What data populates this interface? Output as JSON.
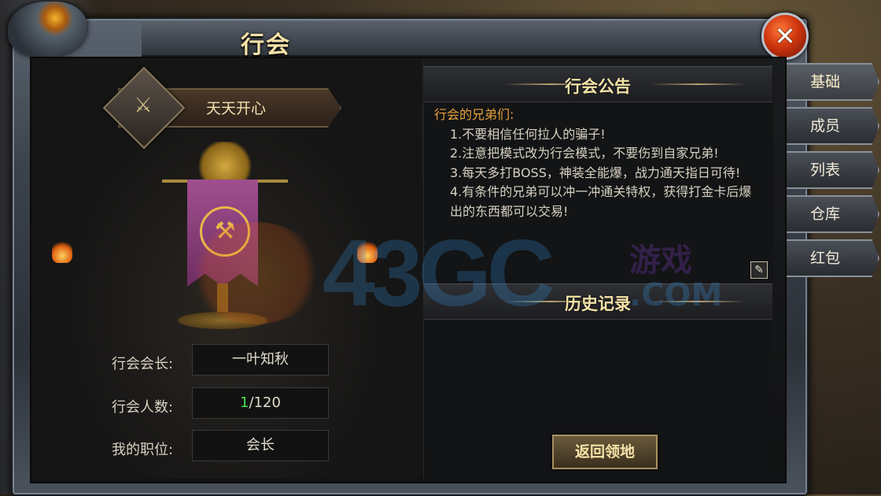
{
  "window": {
    "title": "行会",
    "close_icon": "close-icon"
  },
  "guild": {
    "name": "天天开心",
    "emblem_icon": "crossed-axes-icon"
  },
  "stats": [
    {
      "label": "行会会长:",
      "value": "一叶知秋"
    },
    {
      "label": "行会人数:",
      "value_current": "1",
      "value_max": "/120"
    },
    {
      "label": "我的职位:",
      "value": "会长"
    }
  ],
  "notice": {
    "title": "行会公告",
    "greeting": "行会的兄弟们:",
    "lines": [
      "1.不要相信任何拉人的骗子!",
      "2.注意把模式改为行会模式，不要伤到自家兄弟!",
      "3.每天多打BOSS，神装全能爆，战力通天指日可待!",
      "4.有条件的兄弟可以冲一冲通关特权，获得打金卡后爆出的东西都可以交易!"
    ],
    "edit_icon": "edit-icon"
  },
  "history": {
    "title": "历史记录"
  },
  "return_button": "返回领地",
  "tabs": [
    {
      "label": "基础",
      "active": true
    },
    {
      "label": "成员",
      "active": false
    },
    {
      "label": "列表",
      "active": false
    },
    {
      "label": "仓库",
      "active": false
    },
    {
      "label": "红包",
      "active": false
    }
  ],
  "watermark": {
    "number": "43GC",
    "cn": "游戏",
    "com": ".COM"
  },
  "colors": {
    "accent_gold": "#f4e2a8",
    "notice_head": "#e7a23c",
    "count_green": "#4be04b",
    "banner_purple": "#a04f8e"
  }
}
